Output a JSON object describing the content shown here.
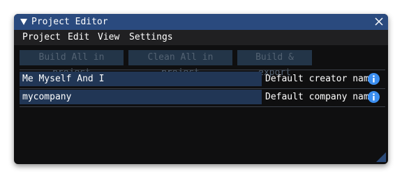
{
  "window": {
    "title": "Project Editor",
    "icons": {
      "collapse": "triangle-down-icon",
      "close": "close-icon",
      "info": "info-icon",
      "resize": "resize-grip-icon"
    }
  },
  "menu": [
    "Project",
    "Edit",
    "View",
    "Settings"
  ],
  "toolbar": {
    "build_all": "Build All in project",
    "clean_all": "Clean All in project",
    "build_export": "Build & export"
  },
  "fields": [
    {
      "value": "Me Myself And I",
      "label": "Default creator name"
    },
    {
      "value": "mycompany",
      "label": "Default company name"
    }
  ],
  "colors": {
    "titlebar": "#2a4a7e",
    "menubar": "#202022",
    "body": "#0f0f10",
    "field": "#213655",
    "button_disabled": "#233548",
    "info_accent": "#3b8ef0"
  }
}
